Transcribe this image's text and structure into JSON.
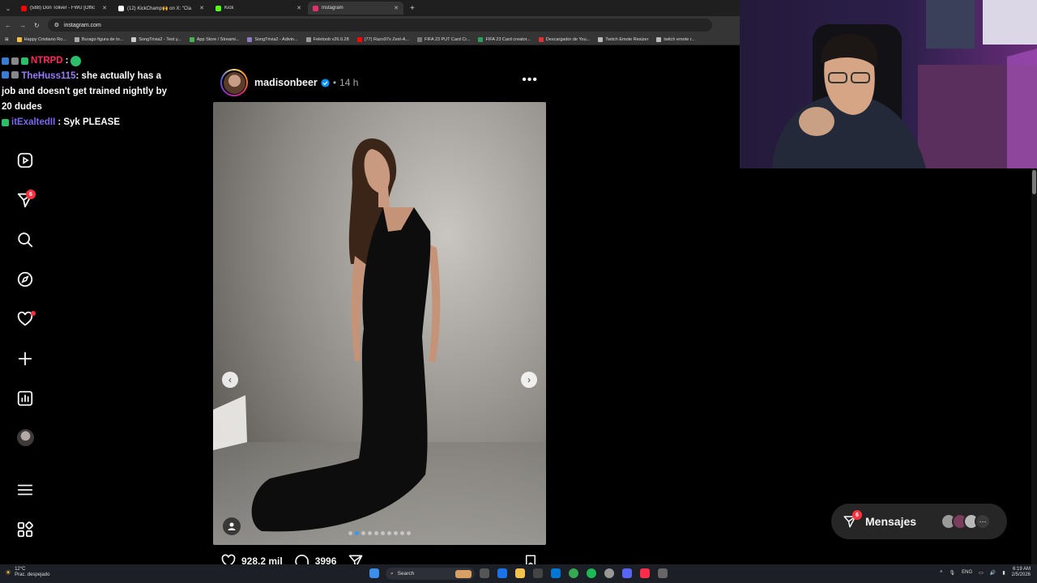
{
  "browser": {
    "tabs": [
      {
        "title": "(588) Don Toliver - FWU [Offic",
        "color": "#ff0000",
        "active": false
      },
      {
        "title": "(12) KickChamp🙌 on X: \"Cla",
        "color": "#ffffff",
        "active": false
      },
      {
        "title": "Kick",
        "color": "#53fc18",
        "active": false
      },
      {
        "title": "Instagram",
        "color": "#e1306c",
        "active": true
      }
    ],
    "url": "instagram.com",
    "bookmarks": [
      "Happy Cristiano Ro...",
      "Burago figura de to...",
      "SongTrivia2 - Test y...",
      "App Store / Streami...",
      "SongTrivia2 - Adivin...",
      "Feletoob v26.0.28",
      "(77) Razo97s Zest-A...",
      "FIFA 23 PUT Card Cr...",
      "FIFA 23 Card creator...",
      "Descargador de You...",
      "Twitch Emote Resizer",
      "twitch emote r..."
    ]
  },
  "chat": {
    "messages": [
      {
        "user": "NTRPD",
        "text": ""
      },
      {
        "user": "TheHuss115",
        "text": ": she actually has a job and doesn't get trained nightly by 20 dudes"
      },
      {
        "user": "itExaltedII",
        "text": ": Syk PLEASE"
      }
    ]
  },
  "sidebar": {
    "notifications_badge": "6"
  },
  "post": {
    "username": "madisonbeer",
    "time": "14 h",
    "likes": "928,2 mil",
    "comments": "3996",
    "carousel_count": 10,
    "carousel_index": 1
  },
  "messages_pill": {
    "label": "Mensajes",
    "badge": "6"
  },
  "taskbar": {
    "temperature": "12°C",
    "weather": "Prac. despejado",
    "search_label": "Search",
    "language": "ENG",
    "time": "6:19 AM",
    "date": "2/5/2026"
  },
  "colors": {
    "accent_red": "#ff3040",
    "instagram_blue": "#3897f0"
  }
}
